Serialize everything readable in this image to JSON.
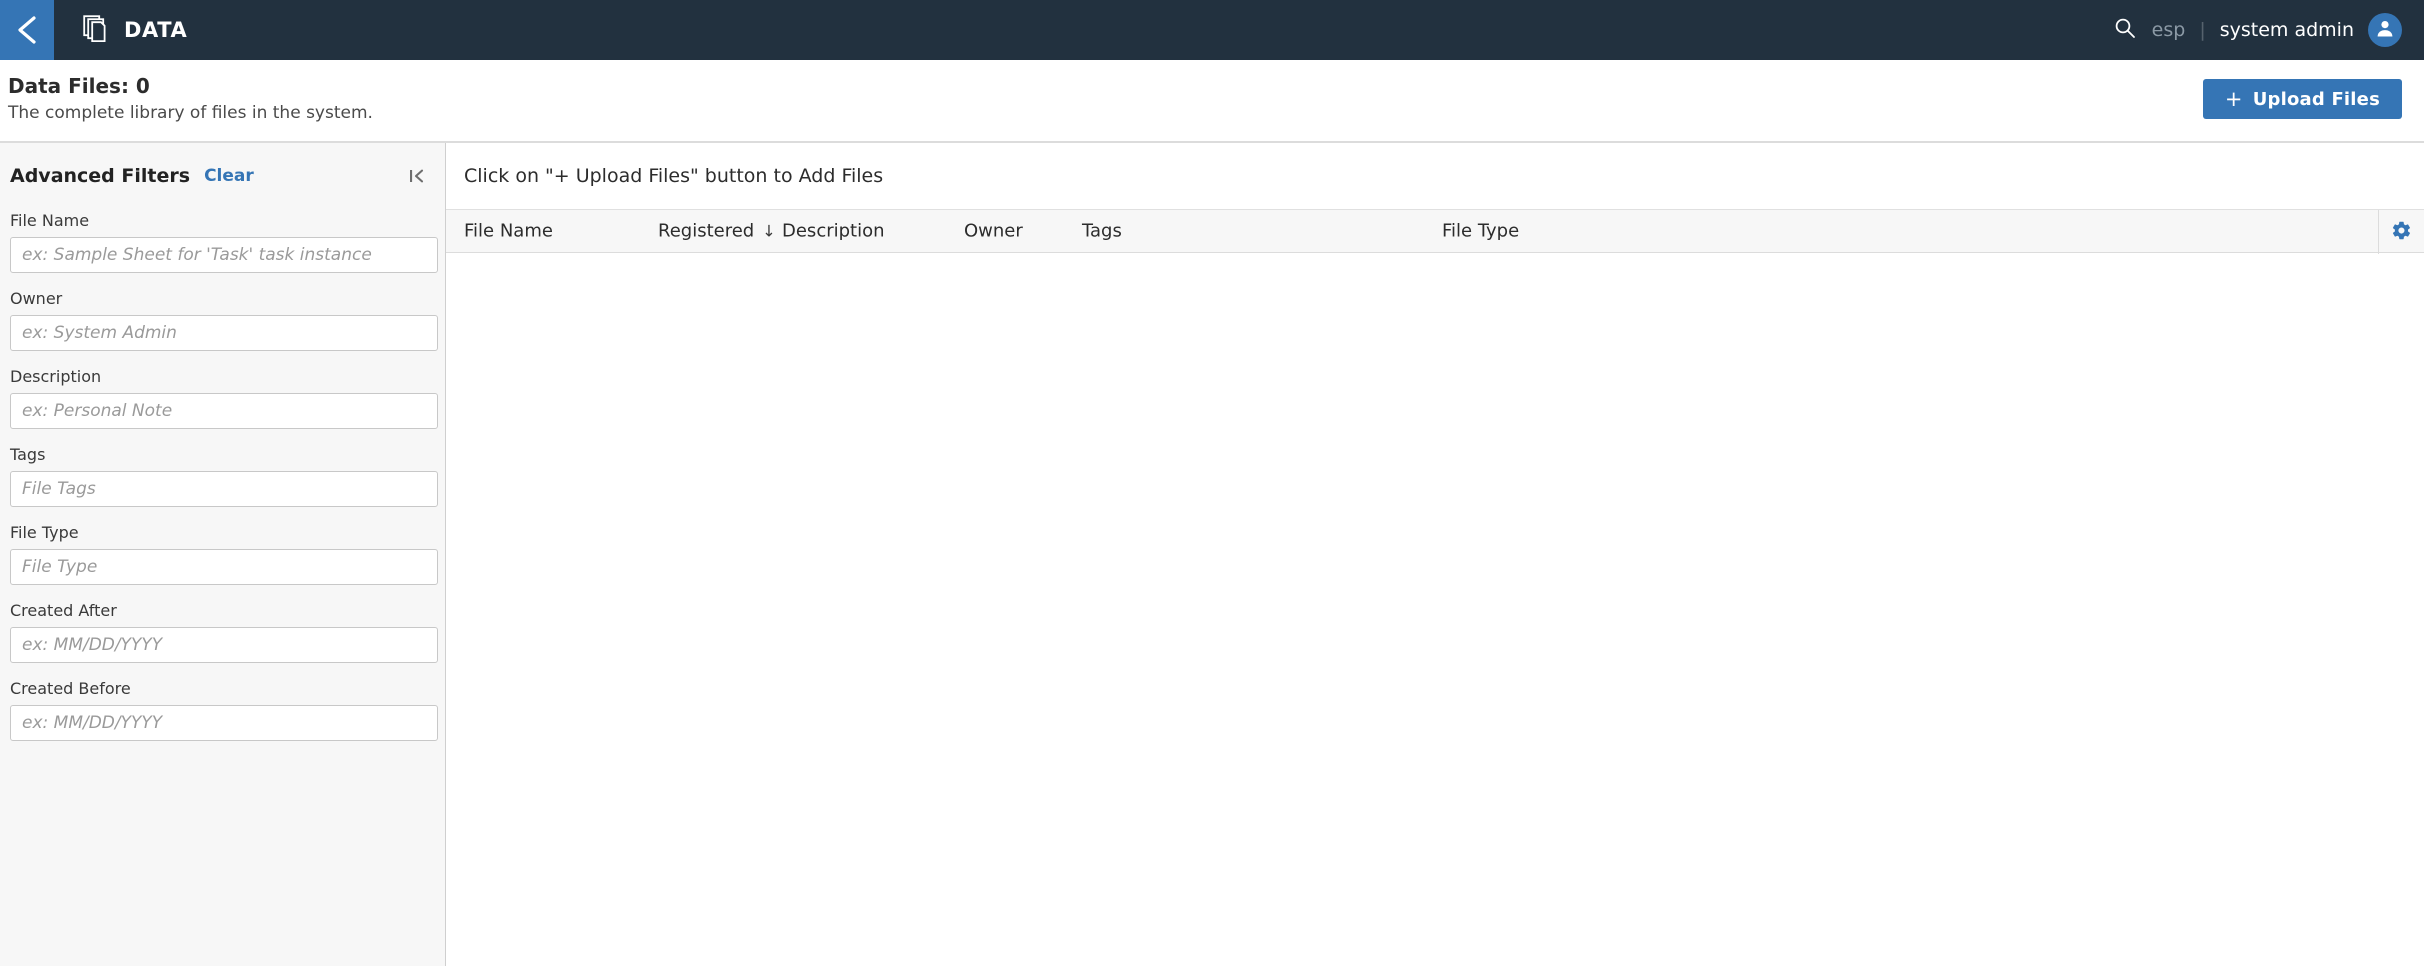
{
  "appbar": {
    "back_icon": "chevron-left-icon",
    "app_icon": "files-stack-icon",
    "title": "DATA",
    "search_icon": "search-icon",
    "language": "esp",
    "separator": "|",
    "user": "system admin",
    "avatar_icon": "user-avatar-icon",
    "accent_color": "#3575b5",
    "bar_color": "#22313f"
  },
  "pagehead": {
    "title": "Data Files: 0",
    "subtitle": "The complete library of files in the system.",
    "upload_plus": "+",
    "upload_label": "Upload Files"
  },
  "filters": {
    "title": "Advanced Filters",
    "clear_label": "Clear",
    "collapse_icon": "collapse-panel-left-icon",
    "fields": [
      {
        "label": "File Name",
        "placeholder": "ex: Sample Sheet for 'Task' task instance",
        "value": ""
      },
      {
        "label": "Owner",
        "placeholder": "ex: System Admin",
        "value": ""
      },
      {
        "label": "Description",
        "placeholder": "ex: Personal Note",
        "value": ""
      },
      {
        "label": "Tags",
        "placeholder": "File Tags",
        "value": ""
      },
      {
        "label": "File Type",
        "placeholder": "File Type",
        "value": ""
      },
      {
        "label": "Created After",
        "placeholder": "ex: MM/DD/YYYY",
        "value": ""
      },
      {
        "label": "Created Before",
        "placeholder": "ex: MM/DD/YYYY",
        "value": ""
      }
    ]
  },
  "table": {
    "empty_message": "Click on \"+ Upload Files\" button to Add Files",
    "columns": [
      {
        "label": "File Name",
        "sorted": false
      },
      {
        "label": "Registered",
        "sorted": true,
        "sort_arrow": "↓"
      },
      {
        "label": "Description",
        "sorted": false
      },
      {
        "label": "Owner",
        "sorted": false
      },
      {
        "label": "Tags",
        "sorted": false
      },
      {
        "label": "File Type",
        "sorted": false
      }
    ],
    "settings_icon": "gear-icon",
    "rows": []
  }
}
